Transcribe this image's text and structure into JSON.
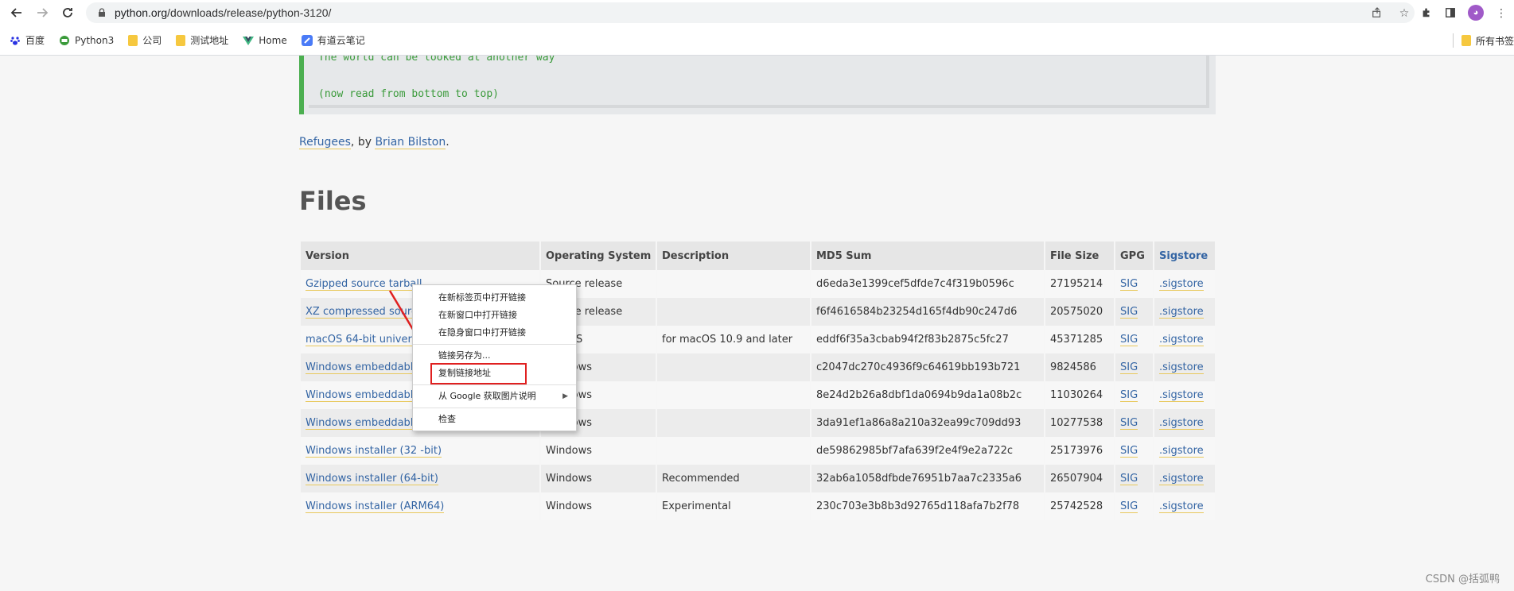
{
  "browser": {
    "url_host": "python.org",
    "url_path": "/downloads/release/python-3120/",
    "back_icon": "arrow-left-icon",
    "forward_icon": "arrow-right-icon",
    "reload_icon": "reload-icon"
  },
  "bookmarks": [
    {
      "label": "百度",
      "icon": "baidu-paw-icon",
      "color": "#2932e1"
    },
    {
      "label": "Python3",
      "icon": "python-site-icon",
      "color": "#3a9a3a"
    },
    {
      "label": "公司",
      "icon": "folder-icon",
      "color": "#f6c83f"
    },
    {
      "label": "测试地址",
      "icon": "folder-icon",
      "color": "#f6c83f"
    },
    {
      "label": "Home",
      "icon": "vue-logo-icon",
      "color": "#41b883"
    },
    {
      "label": "有道云笔记",
      "icon": "youdao-note-icon",
      "color": "#4a7bf7"
    }
  ],
  "bookmarks_right": {
    "label": "所有书签",
    "icon": "folder-icon"
  },
  "code": {
    "line1": "The world can be looked at another way",
    "line2": "(now read from bottom to top)"
  },
  "credit": {
    "link1": "Refugees",
    "mid": ", by ",
    "link2": "Brian Bilston",
    "end": "."
  },
  "files_title": "Files",
  "table": {
    "headers": [
      "Version",
      "Operating System",
      "Description",
      "MD5 Sum",
      "File Size",
      "GPG",
      "Sigstore"
    ],
    "rows": [
      {
        "version": "Gzipped source tarball",
        "os": "Source release",
        "desc": "",
        "md5": "d6eda3e1399cef5dfde7c4f319b0596c",
        "size": "27195214",
        "gpg": "SIG",
        "sig": ".sigstore"
      },
      {
        "version": "XZ compressed source tarball",
        "os": "Source release",
        "desc": "",
        "md5": "f6f4616584b23254d165f4db90c247d6",
        "size": "20575020",
        "gpg": "SIG",
        "sig": ".sigstore"
      },
      {
        "version": "macOS 64-bit universal2 installer",
        "os": "macOS",
        "desc": "for macOS 10.9 and later",
        "md5": "eddf6f35a3cbab94f2f83b2875c5fc27",
        "size": "45371285",
        "gpg": "SIG",
        "sig": ".sigstore"
      },
      {
        "version": "Windows embeddable package (32-bit)",
        "os": "Windows",
        "desc": "",
        "md5": "c2047dc270c4936f9c64619bb193b721",
        "size": "9824586",
        "gpg": "SIG",
        "sig": ".sigstore"
      },
      {
        "version": "Windows embeddable package (64-bit)",
        "os": "Windows",
        "desc": "",
        "md5": "8e24d2b26a8dbf1da0694b9da1a08b2c",
        "size": "11030264",
        "gpg": "SIG",
        "sig": ".sigstore"
      },
      {
        "version": "Windows embeddable package (ARM64)",
        "os": "Windows",
        "desc": "",
        "md5": "3da91ef1a86a8a210a32ea99c709dd93",
        "size": "10277538",
        "gpg": "SIG",
        "sig": ".sigstore"
      },
      {
        "version": "Windows installer (32 -bit)",
        "os": "Windows",
        "desc": "",
        "md5": "de59862985bf7afa639f2e4f9e2a722c",
        "size": "25173976",
        "gpg": "SIG",
        "sig": ".sigstore"
      },
      {
        "version": "Windows installer (64-bit)",
        "os": "Windows",
        "desc": "Recommended",
        "md5": "32ab6a1058dfbde76951b7aa7c2335a6",
        "size": "26507904",
        "gpg": "SIG",
        "sig": ".sigstore"
      },
      {
        "version": "Windows installer (ARM64)",
        "os": "Windows",
        "desc": "Experimental",
        "md5": "230c703e3b8b3d92765d118afa7b2f78",
        "size": "25742528",
        "gpg": "SIG",
        "sig": ".sigstore"
      }
    ]
  },
  "context_menu": {
    "items": [
      "在新标签页中打开链接",
      "在新窗口中打开链接",
      "在隐身窗口中打开链接",
      "链接另存为...",
      "复制链接地址",
      "从 Google 获取图片说明",
      "检查"
    ]
  },
  "watermark": "CSDN @括弧鸭",
  "colors": {
    "link": "#3465a4",
    "annotation_red": "#e02020",
    "code_green": "#3a9a3a"
  }
}
